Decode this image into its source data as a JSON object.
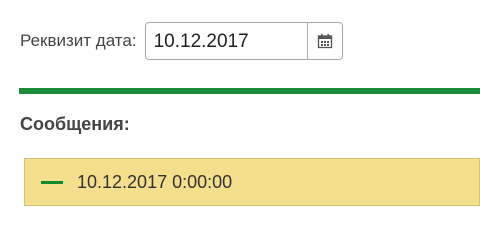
{
  "requisite": {
    "label": "Реквизит дата:",
    "value": "10.12.2017"
  },
  "messages": {
    "title": "Сообщения:",
    "items": [
      {
        "text": "10.12.2017 0:00:00"
      }
    ]
  },
  "colors": {
    "accent_bar": "#1a8c3a",
    "message_background": "#f4df8c",
    "collapse_icon": "#0f8a2f"
  },
  "icons": {
    "calendar": "calendar-icon",
    "collapse": "collapse-minus-icon"
  }
}
